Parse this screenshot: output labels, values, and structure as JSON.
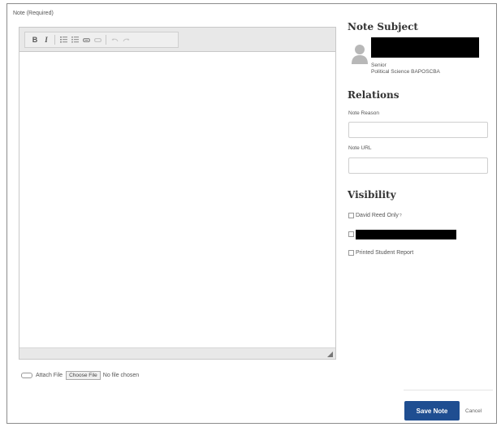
{
  "note": {
    "label": "Note (Required)",
    "toolbar": [
      {
        "name": "bold-button",
        "glyph": "B"
      },
      {
        "name": "italic-button",
        "glyph": "I"
      },
      {
        "name": "numbered-list-button",
        "glyph": "⁝≡"
      },
      {
        "name": "bulleted-list-button",
        "glyph": "⁝≡"
      },
      {
        "name": "link-button",
        "glyph": "⚭"
      },
      {
        "name": "unlink-button",
        "glyph": "⚭"
      },
      {
        "name": "undo-button",
        "glyph": "↶"
      },
      {
        "name": "redo-button",
        "glyph": "↷"
      }
    ],
    "body": ""
  },
  "attach": {
    "label": "Attach File",
    "choose_label": "Choose File",
    "status": "No file chosen"
  },
  "subject": {
    "heading": "Note Subject",
    "class_level": "Senior",
    "major": "Political Science BAPOSCBA"
  },
  "relations": {
    "heading": "Relations",
    "reason_label": "Note Reason",
    "reason_value": "",
    "url_label": "Note URL",
    "url_value": ""
  },
  "visibility": {
    "heading": "Visibility",
    "options": [
      {
        "label": "David Reed Only",
        "checked": false,
        "help": "?"
      },
      {
        "label": "",
        "checked": false
      },
      {
        "label": "Printed Student Report",
        "checked": false
      }
    ]
  },
  "actions": {
    "save_label": "Save Note",
    "cancel_label": "Cancel"
  },
  "colors": {
    "primary": "#1f4e91",
    "toolbar": "#e8e8e8",
    "redaction": "#000000"
  }
}
